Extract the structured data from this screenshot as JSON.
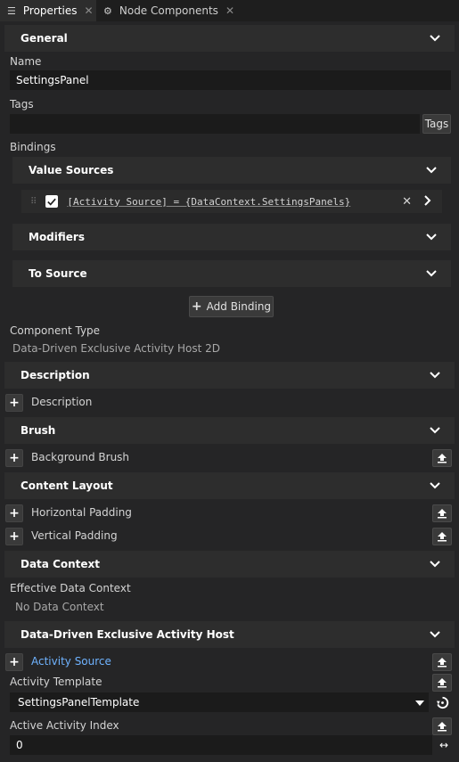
{
  "tabs": [
    {
      "label": "Properties",
      "icon": "list-icon",
      "active": true
    },
    {
      "label": "Node Components",
      "icon": "nodes-icon",
      "active": false
    }
  ],
  "sections": {
    "general": "General",
    "description": "Description",
    "brush": "Brush",
    "content_layout": "Content Layout",
    "data_context": "Data Context",
    "ddeah": "Data-Driven Exclusive Activity Host"
  },
  "general": {
    "name_label": "Name",
    "name_value": "SettingsPanel",
    "tags_label": "Tags",
    "tags_value": "",
    "tags_button": "Tags",
    "bindings_label": "Bindings",
    "value_sources": "Value Sources",
    "binding_expr": "[Activity Source] = {DataContext.SettingsPanels}",
    "modifiers": "Modifiers",
    "to_source": "To Source",
    "add_binding": "Add Binding",
    "component_type_label": "Component Type",
    "component_type_value": "Data-Driven Exclusive Activity Host 2D"
  },
  "description": {
    "item": "Description"
  },
  "brush": {
    "item": "Background Brush"
  },
  "content_layout": {
    "horizontal": "Horizontal Padding",
    "vertical": "Vertical Padding"
  },
  "data_context": {
    "effective_label": "Effective Data Context",
    "effective_value": "No Data Context"
  },
  "ddeah": {
    "activity_source": "Activity Source",
    "activity_template_label": "Activity Template",
    "activity_template_value": "SettingsPanelTemplate",
    "active_index_label": "Active Activity Index",
    "active_index_value": "0"
  },
  "colors": {
    "background": "#252526",
    "section": "#2d2d2d",
    "input": "#1b1b1b",
    "link": "#6fb3ff"
  }
}
